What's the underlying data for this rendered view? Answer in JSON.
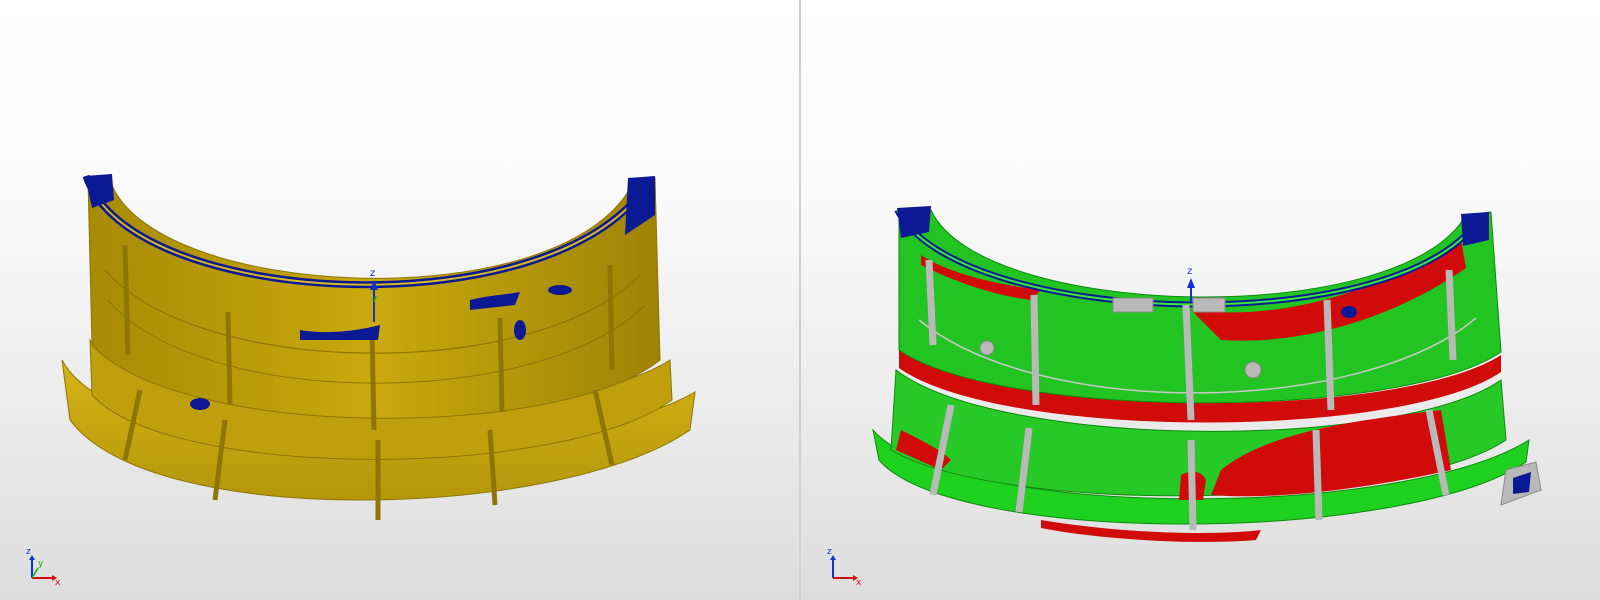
{
  "viewports": [
    {
      "id": "measured-scan",
      "scan_color": "#c9a90c",
      "edge_color": "#0b1a94",
      "center_axis_label": "z",
      "triad": {
        "x": "x",
        "y": "y",
        "z": "z"
      }
    },
    {
      "id": "deviation-map",
      "in_tolerance_color": "#1fd11f",
      "out_of_tolerance_color": "#d10a0a",
      "missing_data_color": "#0b1a94",
      "nominal_color": "#b9b9b9",
      "center_axis_label": "z",
      "triad": {
        "x": "x",
        "z": "z"
      }
    }
  ],
  "axis_colors": {
    "x": "#d01010",
    "y": "#10b010",
    "z": "#1030d0"
  }
}
